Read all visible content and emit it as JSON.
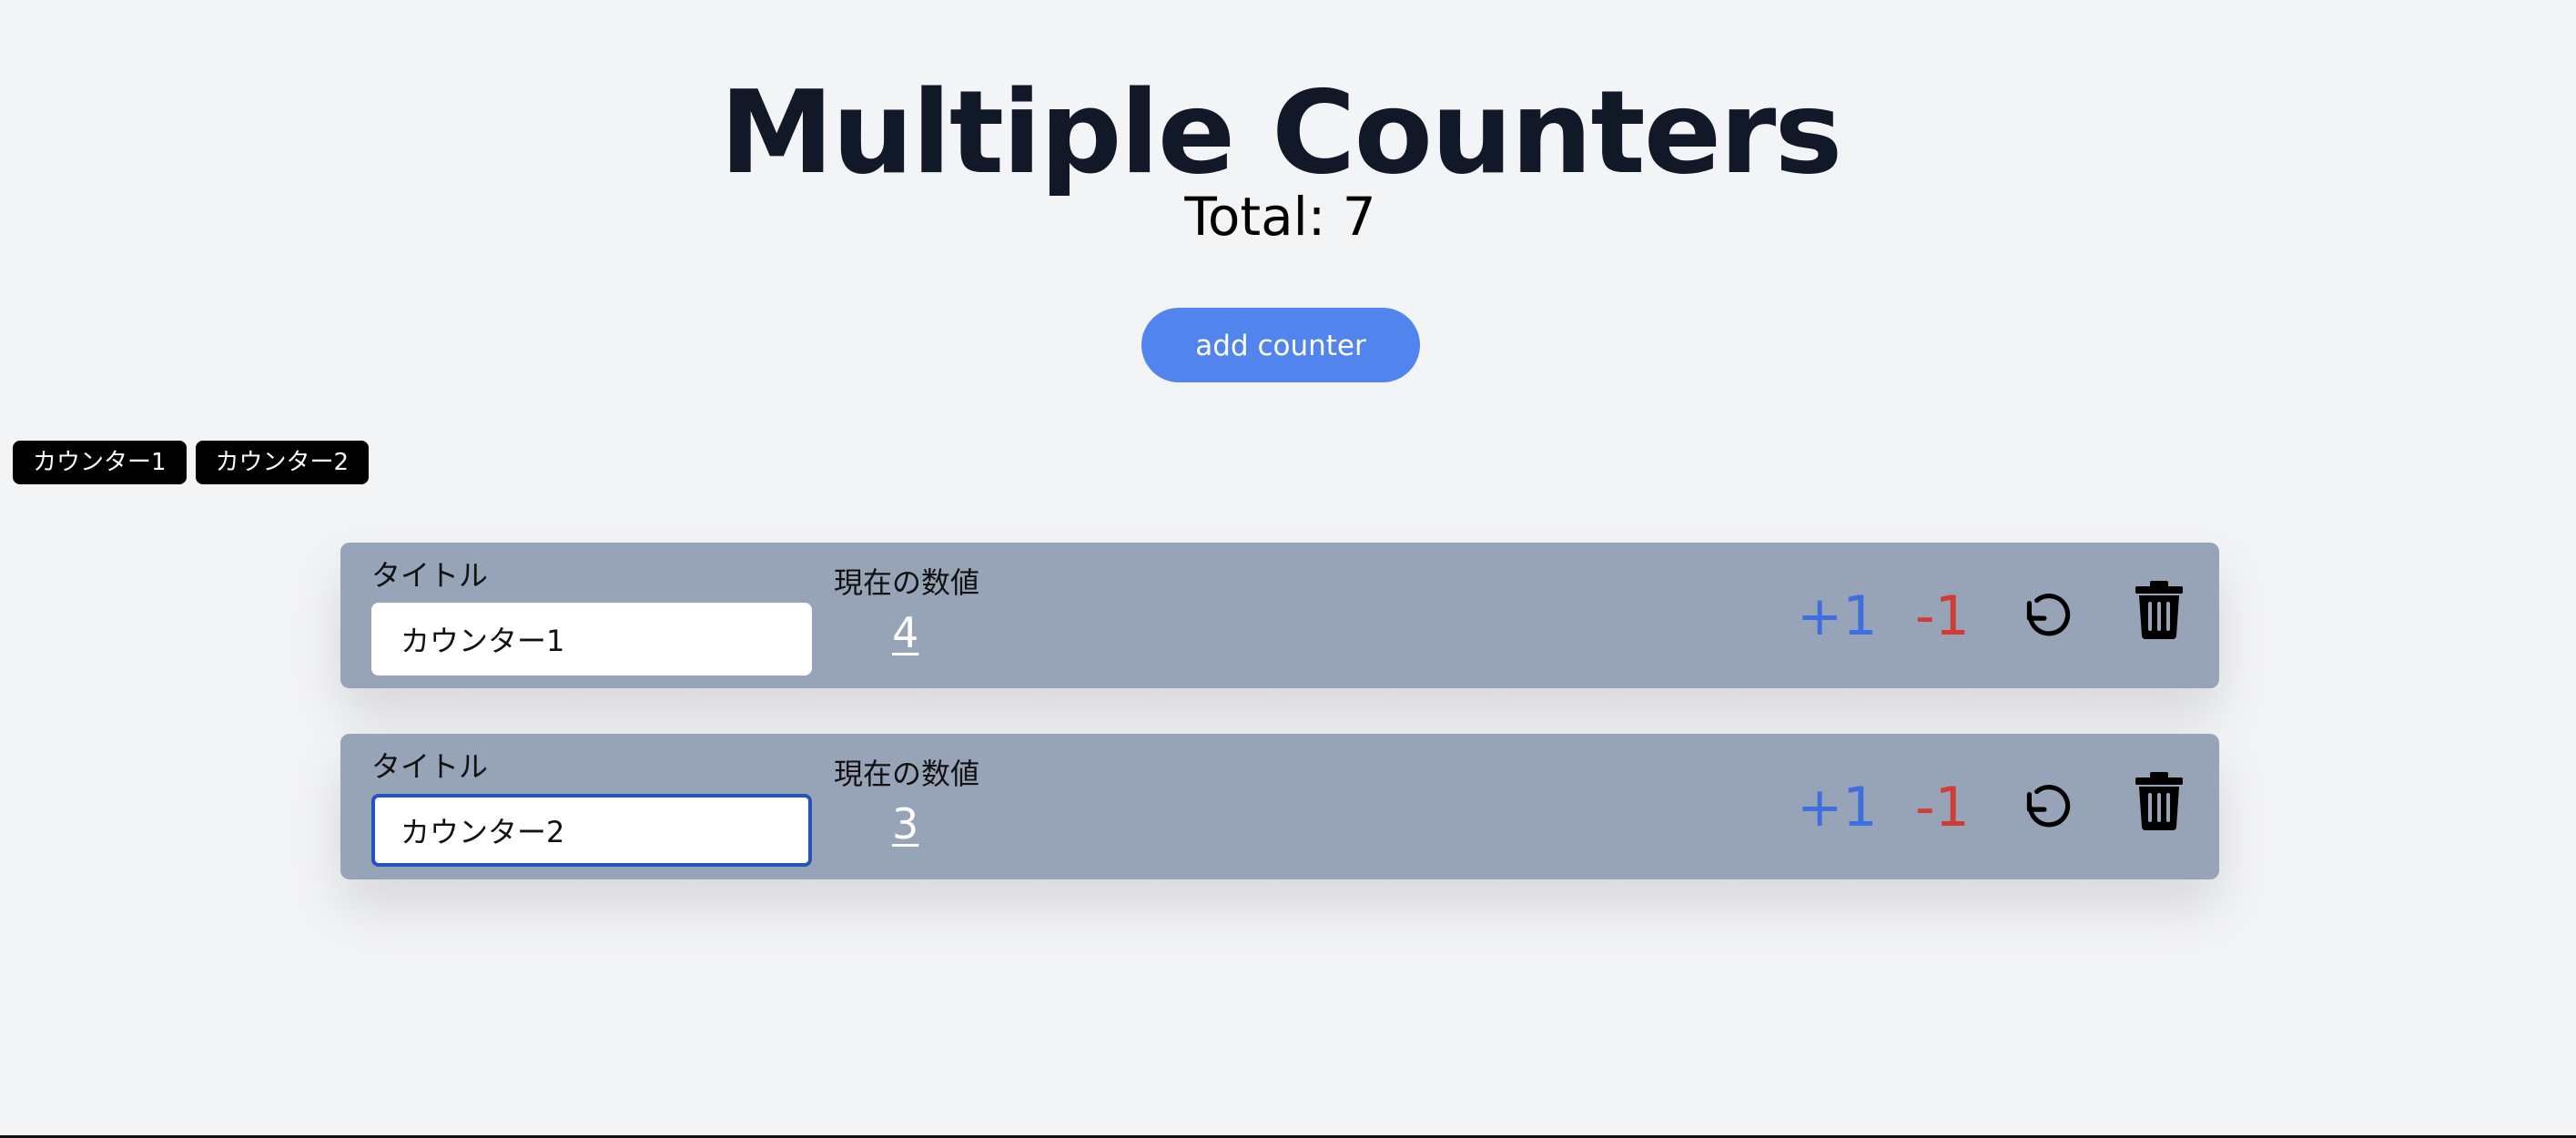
{
  "header": {
    "title": "Multiple Counters",
    "total": "Total: 7"
  },
  "actions": {
    "add_label": "add counter"
  },
  "tabs": [
    {
      "label": "カウンター1"
    },
    {
      "label": "カウンター2"
    }
  ],
  "counters": [
    {
      "title_label": "タイトル",
      "title_value": "カウンター1",
      "value_label": "現在の数値",
      "value": "4",
      "inc_label": "+1",
      "dec_label": "-1",
      "focused": false
    },
    {
      "title_label": "タイトル",
      "title_value": "カウンター2",
      "value_label": "現在の数値",
      "value": "3",
      "inc_label": "+1",
      "dec_label": "-1",
      "focused": true
    }
  ],
  "icons": {
    "reset": "reset-icon",
    "delete": "trash-icon"
  },
  "colors": {
    "background": "#f3f4f6",
    "card": "#97a3b6",
    "add_button": "#5284ee",
    "increment": "#3f6ee0",
    "decrement": "#d13b33",
    "tab": "#000000"
  }
}
